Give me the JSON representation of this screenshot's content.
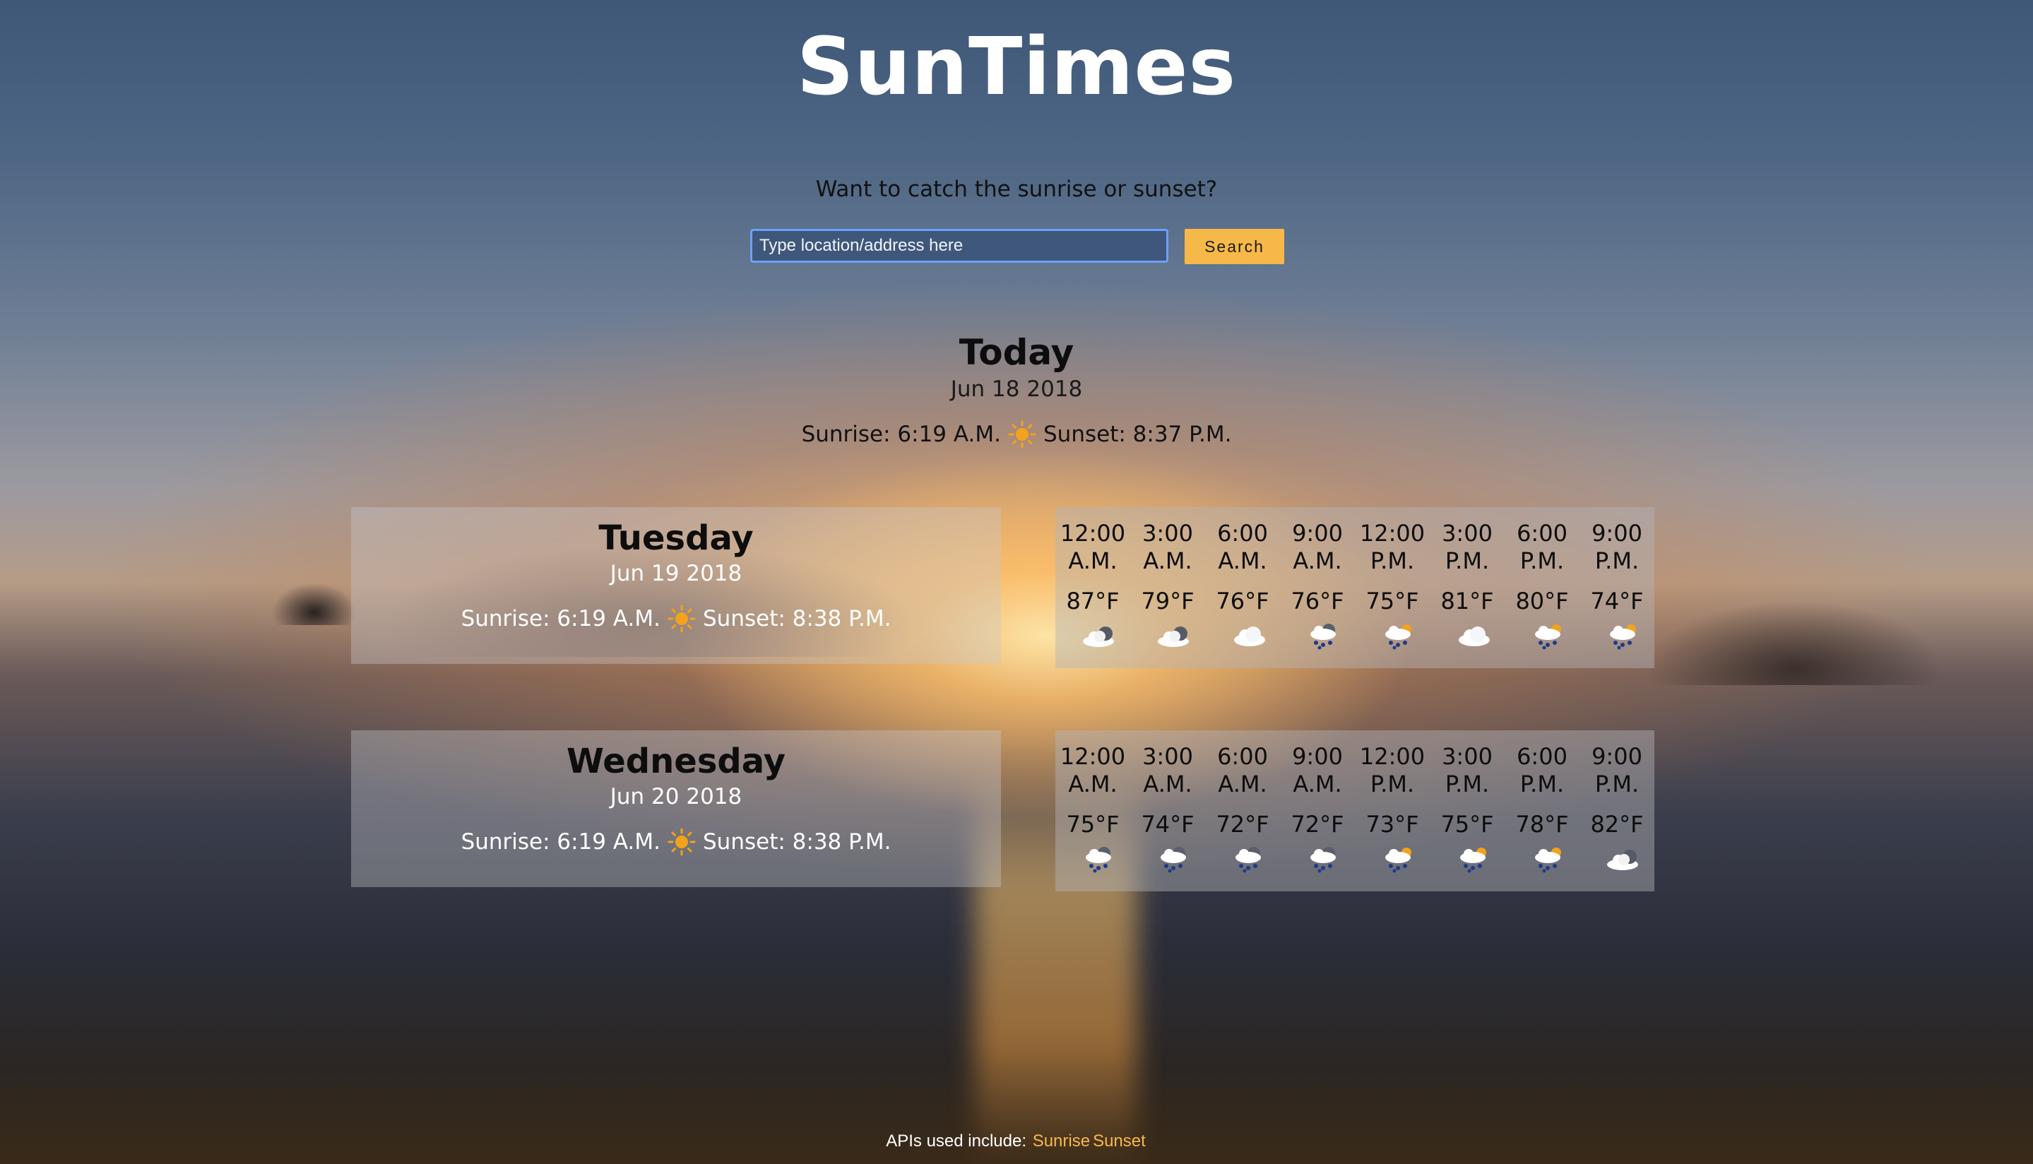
{
  "app": {
    "title": "SunTimes"
  },
  "search": {
    "prompt": "Want to catch the sunrise or sunset?",
    "placeholder": "Type location/address here",
    "value": "",
    "button_label": "Search"
  },
  "today": {
    "heading": "Today",
    "date": "Jun 18 2018",
    "sunrise": "Sunrise: 6:19 A.M.",
    "sunset": "Sunset: 8:37 P.M.",
    "sun_icon": "sun-icon"
  },
  "days": [
    {
      "name": "Tuesday",
      "date": "Jun 19 2018",
      "sunrise": "Sunrise: 6:19 A.M.",
      "sunset": "Sunset: 8:38 P.M.",
      "forecast": [
        {
          "time": "12:00",
          "period": "A.M.",
          "temp": "87°F",
          "icon": "dark-cloud-icon"
        },
        {
          "time": "3:00",
          "period": "A.M.",
          "temp": "79°F",
          "icon": "dark-cloud-icon"
        },
        {
          "time": "6:00",
          "period": "A.M.",
          "temp": "76°F",
          "icon": "cloud-icon"
        },
        {
          "time": "9:00",
          "period": "A.M.",
          "temp": "76°F",
          "icon": "rain-cloud-icon"
        },
        {
          "time": "12:00",
          "period": "P.M.",
          "temp": "75°F",
          "icon": "sun-rain-cloud-icon"
        },
        {
          "time": "3:00",
          "period": "P.M.",
          "temp": "81°F",
          "icon": "cloud-icon"
        },
        {
          "time": "6:00",
          "period": "P.M.",
          "temp": "80°F",
          "icon": "sun-rain-cloud-icon"
        },
        {
          "time": "9:00",
          "period": "P.M.",
          "temp": "74°F",
          "icon": "sun-rain-cloud-icon"
        }
      ]
    },
    {
      "name": "Wednesday",
      "date": "Jun 20 2018",
      "sunrise": "Sunrise: 6:19 A.M.",
      "sunset": "Sunset: 8:38 P.M.",
      "forecast": [
        {
          "time": "12:00",
          "period": "A.M.",
          "temp": "75°F",
          "icon": "rain-cloud-icon"
        },
        {
          "time": "3:00",
          "period": "A.M.",
          "temp": "74°F",
          "icon": "rain-cloud-icon"
        },
        {
          "time": "6:00",
          "period": "A.M.",
          "temp": "72°F",
          "icon": "rain-cloud-icon"
        },
        {
          "time": "9:00",
          "period": "A.M.",
          "temp": "72°F",
          "icon": "rain-cloud-icon"
        },
        {
          "time": "12:00",
          "period": "P.M.",
          "temp": "73°F",
          "icon": "sun-rain-cloud-icon"
        },
        {
          "time": "3:00",
          "period": "P.M.",
          "temp": "75°F",
          "icon": "sun-rain-cloud-icon"
        },
        {
          "time": "6:00",
          "period": "P.M.",
          "temp": "78°F",
          "icon": "sun-rain-cloud-icon"
        },
        {
          "time": "9:00",
          "period": "P.M.",
          "temp": "82°F",
          "icon": "dark-cloud-icon"
        }
      ]
    }
  ],
  "footer": {
    "text": "APIs used include:",
    "links": [
      "Sunrise",
      "Sunset"
    ]
  },
  "colors": {
    "accent": "#f7b84a",
    "input_border": "#6ea0ff",
    "input_bg": "#3a5278"
  }
}
